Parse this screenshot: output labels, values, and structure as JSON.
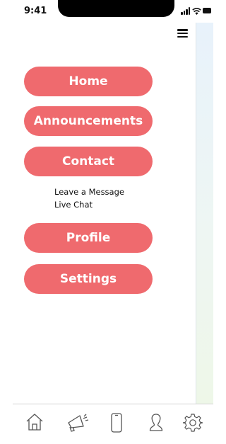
{
  "status_bar": {
    "time": "9:41"
  },
  "menu": {
    "items": [
      {
        "label": "Home"
      },
      {
        "label": "Announcements"
      },
      {
        "label": "Contact"
      },
      {
        "label": "Profile"
      },
      {
        "label": "Settings"
      }
    ],
    "contact_submenu": [
      "Leave a Message",
      "Live Chat"
    ]
  },
  "tab_bar": {
    "icons": [
      "home-icon",
      "megaphone-icon",
      "phone-icon",
      "person-icon",
      "gear-icon"
    ]
  },
  "colors": {
    "menu_button": "#ef6a6e",
    "menu_text": "#ffffff"
  }
}
